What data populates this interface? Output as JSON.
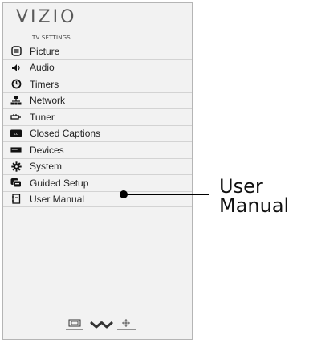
{
  "brand": {
    "logo_text": "VIZIO"
  },
  "menu": {
    "section_title": "TV SETTINGS",
    "items": [
      {
        "label": "Picture",
        "icon": "picture-icon"
      },
      {
        "label": "Audio",
        "icon": "speaker-icon"
      },
      {
        "label": "Timers",
        "icon": "clock-icon"
      },
      {
        "label": "Network",
        "icon": "network-icon"
      },
      {
        "label": "Tuner",
        "icon": "antenna-icon"
      },
      {
        "label": "Closed Captions",
        "icon": "closed-captions-icon"
      },
      {
        "label": "Devices",
        "icon": "devices-icon"
      },
      {
        "label": "System",
        "icon": "gear-icon"
      },
      {
        "label": "Guided Setup",
        "icon": "guided-setup-icon"
      },
      {
        "label": "User Manual",
        "icon": "manual-icon"
      }
    ]
  },
  "bottom_bar": {
    "icons": [
      "input-icon",
      "chevron-down-icon",
      "settings-icon"
    ]
  },
  "callout": {
    "line1": "User",
    "line2": "Manual"
  },
  "colors": {
    "panel": "#f2f2f2",
    "text": "#222222",
    "accent": "#000000"
  }
}
